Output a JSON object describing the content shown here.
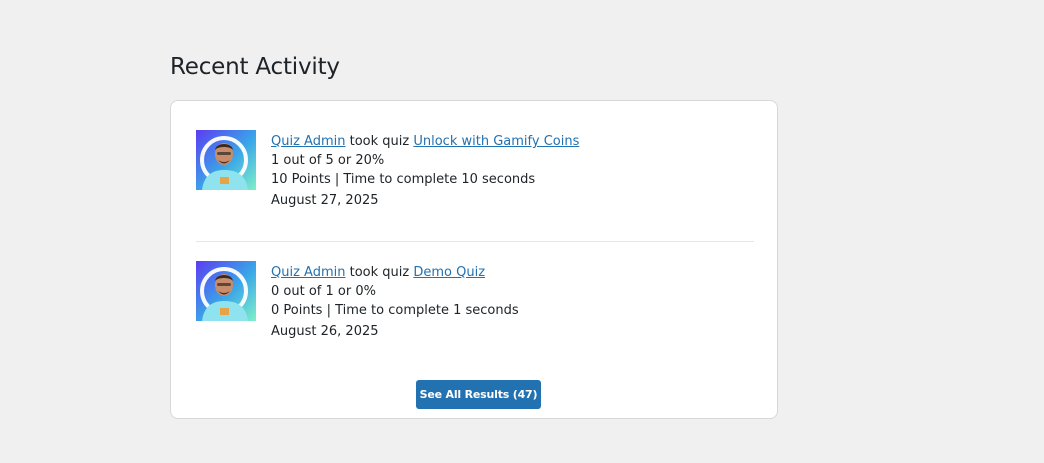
{
  "section": {
    "title": "Recent Activity"
  },
  "activities": [
    {
      "user": "Quiz Admin",
      "verb": "took quiz",
      "quiz": "Unlock with Gamify Coins",
      "score": "1 out of 5 or 20%",
      "points": "10 Points | Time to complete 10 seconds",
      "date": "August 27, 2025",
      "avatar": "user-avatar"
    },
    {
      "user": "Quiz Admin",
      "verb": "took quiz",
      "quiz": "Demo Quiz",
      "score": "0 out of 1 or 0%",
      "points": "0 Points | Time to complete 1 seconds",
      "date": "August 26, 2025",
      "avatar": "user-avatar"
    }
  ],
  "button": {
    "label": "See All Results (47)"
  },
  "colors": {
    "background": "#f0f0f1",
    "link": "#2271b1",
    "button": "#2271b1",
    "text": "#1d2327"
  }
}
